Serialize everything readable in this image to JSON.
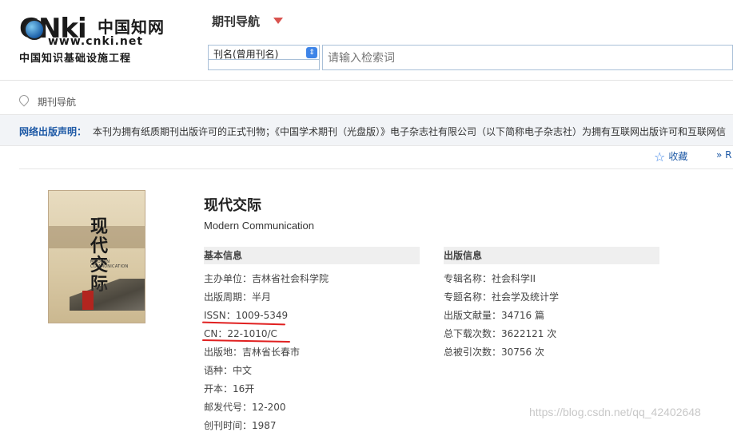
{
  "logo": {
    "brand": "CNki",
    "cn_name": "中国知网",
    "url": "www.cnki.net",
    "subtitle": "中国知识基础设施工程"
  },
  "header": {
    "nav_title": "期刊导航",
    "select_value": "刊名(曾用刊名)",
    "search_placeholder": "请输入检索词"
  },
  "breadcrumb": {
    "text": "期刊导航"
  },
  "notice": {
    "label": "网络出版声明：",
    "text": "本刊为拥有纸质期刊出版许可的正式刊物；《中国学术期刊（光盘版）》电子杂志社有限公司（以下简称电子杂志社）为拥有互联网出版许可和互联网信"
  },
  "toolbar": {
    "favorite_label": "收藏",
    "rss_label": "R"
  },
  "journal": {
    "title_cn": "现代交际",
    "title_en": "Modern Communication"
  },
  "cover": {
    "title": "现代交际",
    "en": "MODERN COMMUNICATION"
  },
  "basic_info": {
    "heading": "基本信息",
    "rows": [
      "主办单位：吉林省社会科学院",
      "出版周期：半月",
      "ISSN：1009-5349",
      "CN：22-1010/C",
      "出版地：吉林省长春市",
      "语种：中文",
      "开本：16开",
      "邮发代号：12-200",
      "创刊时间：1987"
    ]
  },
  "pub_info": {
    "heading": "出版信息",
    "rows": [
      "专辑名称：社会科学II",
      "专题名称：社会学及统计学",
      "出版文献量：34716 篇",
      "总下载次数：3622121 次",
      "总被引次数：30756 次"
    ]
  },
  "annotation": {
    "color": "#e02020"
  },
  "watermark": "https://blog.csdn.net/qq_42402648"
}
